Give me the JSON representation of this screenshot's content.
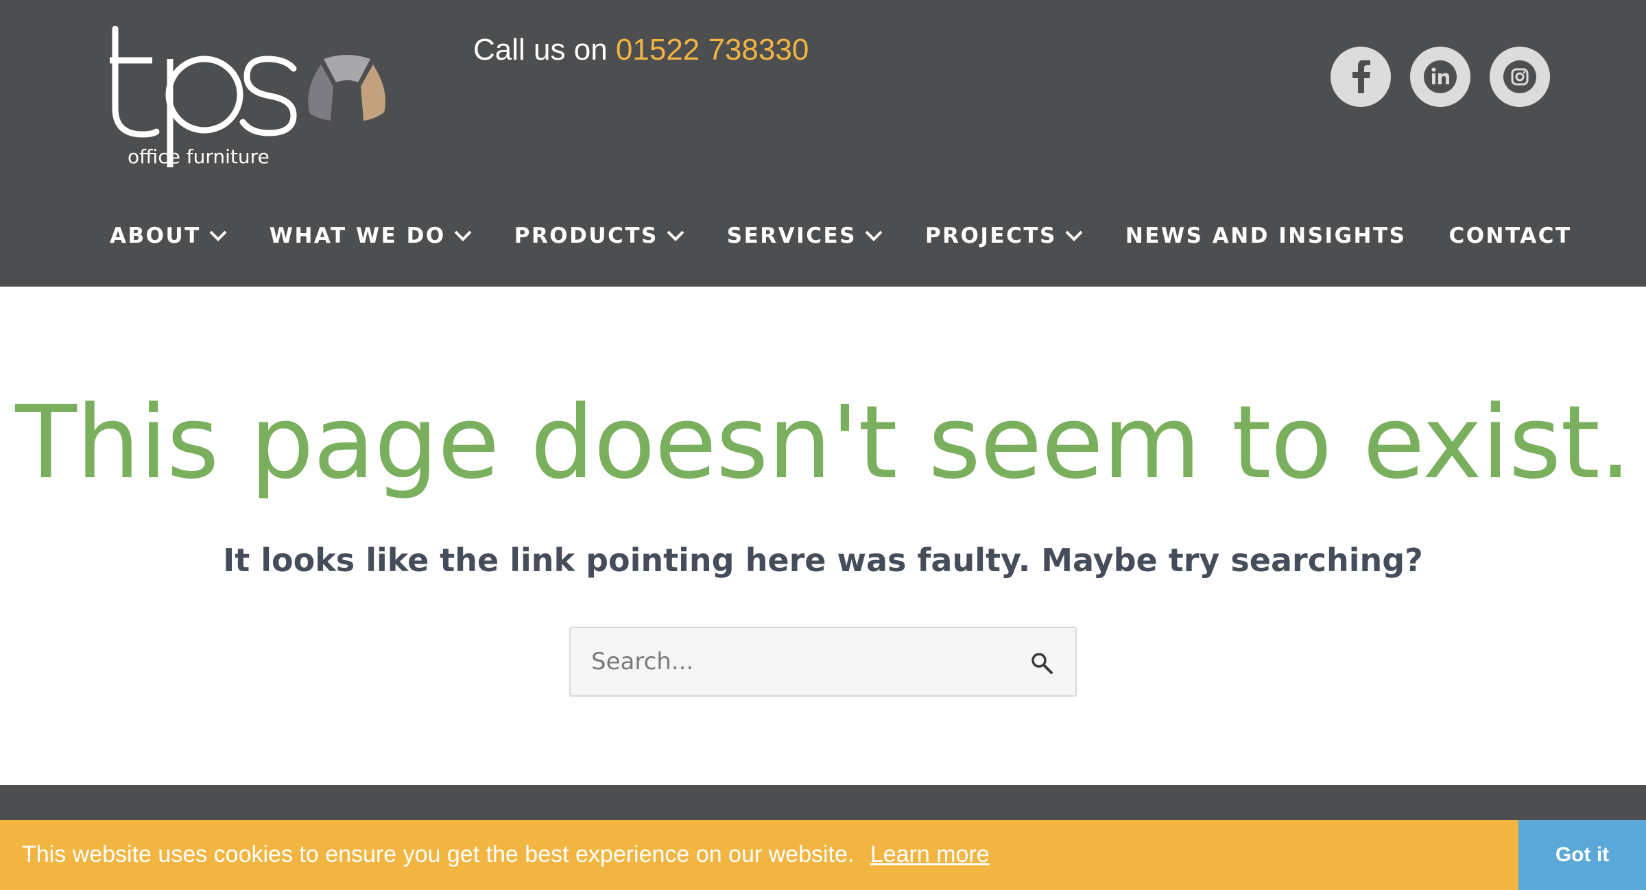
{
  "header": {
    "logo_text": "tps",
    "logo_subtext": "office furniture",
    "phone_prefix": "Call us on",
    "phone_number": "01522 738330",
    "socials": [
      {
        "icon": "facebook-icon"
      },
      {
        "icon": "linkedin-icon"
      },
      {
        "icon": "instagram-icon"
      }
    ]
  },
  "nav": {
    "items": [
      {
        "label": "ABOUT",
        "has_dropdown": true
      },
      {
        "label": "WHAT WE DO",
        "has_dropdown": true
      },
      {
        "label": "PRODUCTS",
        "has_dropdown": true
      },
      {
        "label": "SERVICES",
        "has_dropdown": true
      },
      {
        "label": "PROJECTS",
        "has_dropdown": true
      },
      {
        "label": "NEWS AND INSIGHTS",
        "has_dropdown": false
      },
      {
        "label": "CONTACT",
        "has_dropdown": false
      }
    ]
  },
  "main": {
    "title": "This page doesn't seem to exist.",
    "subtitle": "It looks like the link pointing here was faulty. Maybe try searching?",
    "search_placeholder": "Search..."
  },
  "cookie": {
    "message": "This website uses cookies to ensure you get the best experience on our website.",
    "link_label": "Learn more",
    "button_label": "Got it"
  },
  "colors": {
    "header_bg": "#4d4e50",
    "accent_yellow": "#f3b541",
    "title_green": "#7aaf5e",
    "button_blue": "#5aa8d8"
  }
}
